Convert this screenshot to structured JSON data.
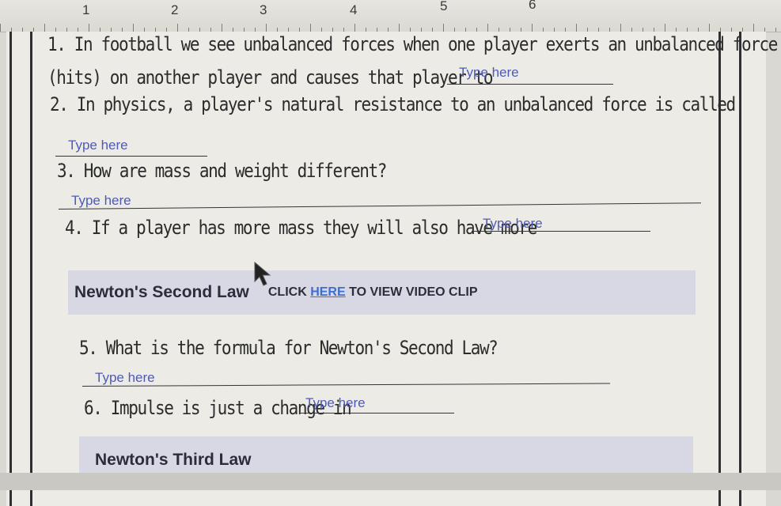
{
  "ruler": {
    "numbers": [
      "1",
      "2",
      "3",
      "4",
      "5",
      "6"
    ]
  },
  "questions": {
    "q1_line1": "1. In football we see unbalanced forces when one player exerts an unbalanced force",
    "q1_line2": "(hits) on another player and causes that player to",
    "q1_answer": "Type here",
    "q2_line1": "2. In physics, a player's natural resistance to an unbalanced force is called",
    "q2_answer": "Type here",
    "q3_line1": "3. How are mass and weight different?",
    "q3_answer": "Type here",
    "q4_line1": "4. If a player has more mass they will also have more",
    "q4_answer": "Type here",
    "q5_line1": "5. What is the formula for Newton's Second Law?",
    "q5_answer": "Type here",
    "q6_line1": "6. Impulse is just a change in",
    "q6_answer": "Type here"
  },
  "banners": {
    "second_title": "Newton's Second Law",
    "second_click": "CLICK",
    "second_here": "HERE",
    "second_rest": "TO VIEW VIDEO CLIP",
    "third_title": "Newton's Third Law"
  },
  "colors": {
    "answer": "#4e5ab8",
    "link": "#3a6fd6",
    "banner_bg": "#d8d8e5"
  }
}
